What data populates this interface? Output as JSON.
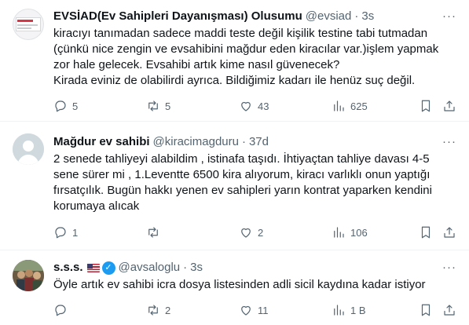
{
  "tweets": [
    {
      "name": "EVSİAD(Ev Sahipleri Dayanışması) Olusumu",
      "handle": "@evsiad",
      "time": "3s",
      "lines": [
        "kiracıyı tanımadan sadece maddi teste değil kişilik testine tabi tutmadan",
        "(çünkü nice zengin ve evsahibini mağdur eden kiracılar var.)işlem yapmak",
        "zor hale gelecek. Evsahibi artık kime nasıl güvenecek?",
        "Kirada eviniz de olabilirdi ayrıca. Bildiğimiz kadarı ile henüz suç değil."
      ],
      "replies": "5",
      "retweets": "5",
      "likes": "43",
      "views": "625"
    },
    {
      "name": "Mağdur ev sahibi",
      "handle": "@kiracimagduru",
      "time": "37d",
      "lines": [
        "2 senede tahliyeyi alabildim , istinafa taşıdı. İhtiyaçtan tahliye davası 4-5",
        "sene sürer mi , 1.Leventte 6500 kira alıyorum, kiracı varlıklı onun yaptığı",
        "fırsatçılık. Bugün hakkı yenen ev sahipleri yarın kontrat yaparken kendini",
        "korumaya alıcak"
      ],
      "replies": "1",
      "retweets": "",
      "likes": "2",
      "views": "106"
    },
    {
      "name": "s.s.s.",
      "handle": "@avsaloglu",
      "time": "3s",
      "lines": [
        "Öyle artık ev sahibi icra dosya listesinden adli sicil kaydına kadar istiyor"
      ],
      "replies": "",
      "retweets": "2",
      "likes": "11",
      "views": "1 B"
    }
  ],
  "ui": {
    "separator": "·",
    "more": "···",
    "verified_mark": "✓"
  },
  "icons": {
    "reply": "reply-icon",
    "retweet": "retweet-icon",
    "like": "heart-icon",
    "views": "views-icon",
    "bookmark": "bookmark-icon",
    "share": "share-icon",
    "more": "more-icon",
    "verified": "verified-badge-icon",
    "flag": "us-flag-icon"
  },
  "colors": {
    "text": "#0f1419",
    "secondary": "#536471",
    "border": "#eff3f4",
    "verified": "#1d9bf0"
  }
}
